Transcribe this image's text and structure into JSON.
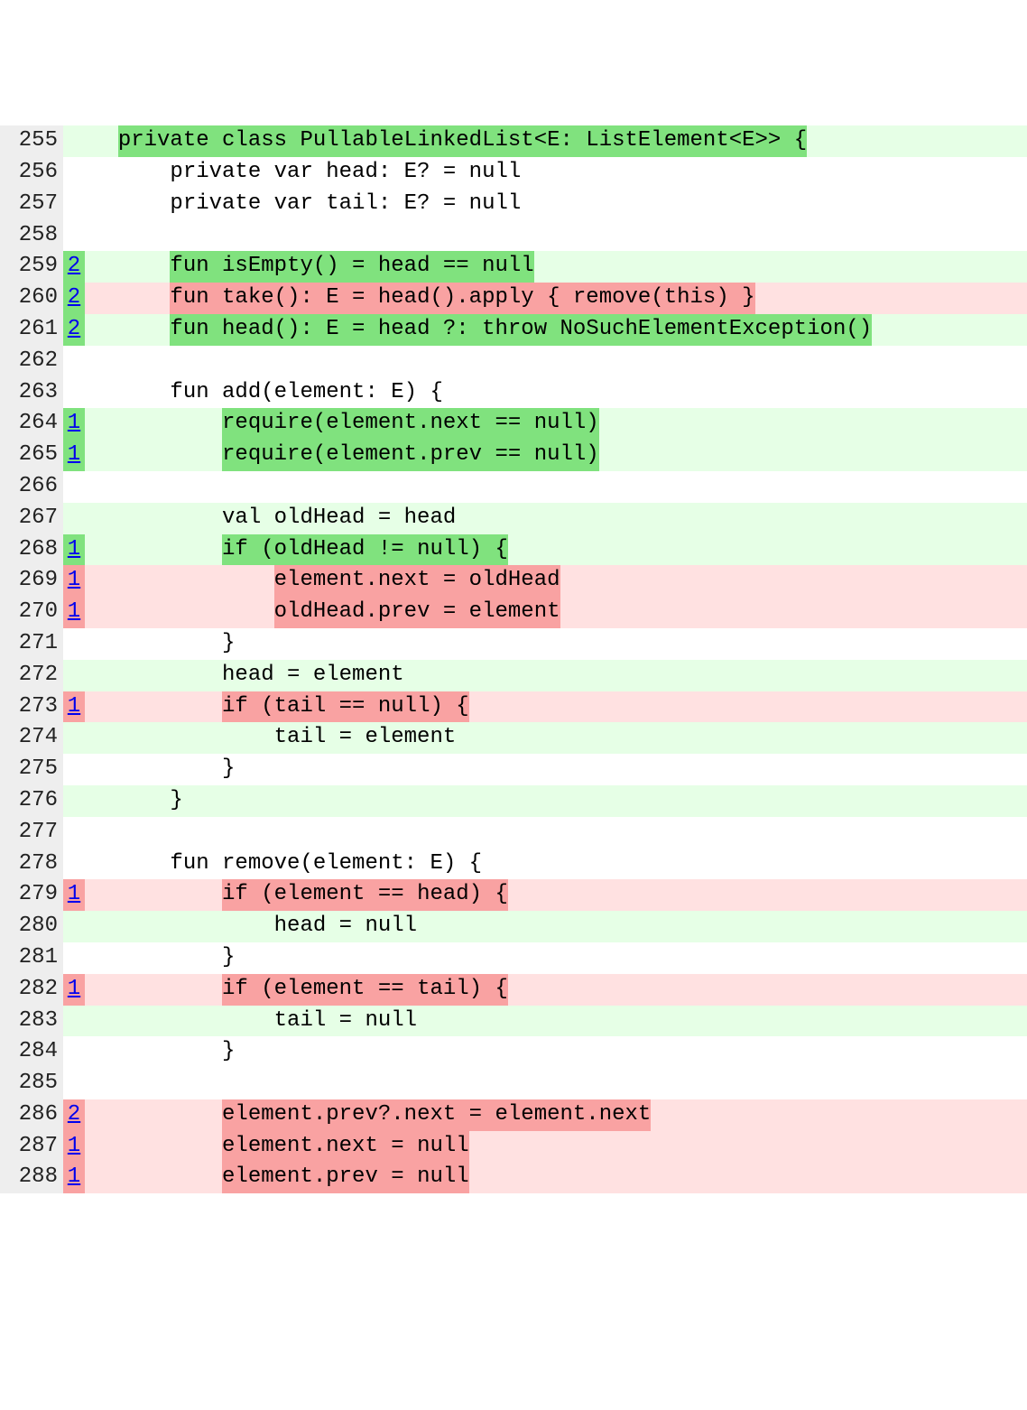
{
  "lines": [
    {
      "n": "255",
      "annot": "",
      "annotCls": "",
      "rowCls": "row-light-green",
      "segs": [
        {
          "t": "  ",
          "cls": ""
        },
        {
          "t": "private class PullableLinkedList<E: ListElement<E>> {",
          "cls": "hl-green"
        }
      ]
    },
    {
      "n": "256",
      "annot": "",
      "annotCls": "",
      "rowCls": "row-white",
      "segs": [
        {
          "t": "      private var head: E? = null",
          "cls": ""
        }
      ]
    },
    {
      "n": "257",
      "annot": "",
      "annotCls": "",
      "rowCls": "row-white",
      "segs": [
        {
          "t": "      private var tail: E? = null",
          "cls": ""
        }
      ]
    },
    {
      "n": "258",
      "annot": "",
      "annotCls": "",
      "rowCls": "row-white",
      "segs": [
        {
          "t": "",
          "cls": ""
        }
      ]
    },
    {
      "n": "259",
      "annot": "2",
      "annotCls": "annot-green",
      "rowCls": "row-light-green",
      "segs": [
        {
          "t": "      ",
          "cls": ""
        },
        {
          "t": "fun isEmpty() = head == null",
          "cls": "hl-green"
        }
      ]
    },
    {
      "n": "260",
      "annot": "2",
      "annotCls": "annot-green",
      "rowCls": "row-light-red",
      "segs": [
        {
          "t": "      ",
          "cls": ""
        },
        {
          "t": "fun take(): E = head().apply { remove(this) }",
          "cls": "hl-red"
        }
      ]
    },
    {
      "n": "261",
      "annot": "2",
      "annotCls": "annot-green",
      "rowCls": "row-light-green",
      "segs": [
        {
          "t": "      ",
          "cls": ""
        },
        {
          "t": "fun head(): E = head ?: throw NoSuchElementException()",
          "cls": "hl-green"
        }
      ]
    },
    {
      "n": "262",
      "annot": "",
      "annotCls": "",
      "rowCls": "row-white",
      "segs": [
        {
          "t": "",
          "cls": ""
        }
      ]
    },
    {
      "n": "263",
      "annot": "",
      "annotCls": "",
      "rowCls": "row-white",
      "segs": [
        {
          "t": "      fun add(element: E) {",
          "cls": ""
        }
      ]
    },
    {
      "n": "264",
      "annot": "1",
      "annotCls": "annot-green",
      "rowCls": "row-light-green",
      "segs": [
        {
          "t": "          ",
          "cls": ""
        },
        {
          "t": "require(element.next == null)",
          "cls": "hl-green"
        }
      ]
    },
    {
      "n": "265",
      "annot": "1",
      "annotCls": "annot-green",
      "rowCls": "row-light-green",
      "segs": [
        {
          "t": "          ",
          "cls": ""
        },
        {
          "t": "require(element.prev == null)",
          "cls": "hl-green"
        }
      ]
    },
    {
      "n": "266",
      "annot": "",
      "annotCls": "",
      "rowCls": "row-white",
      "segs": [
        {
          "t": "",
          "cls": ""
        }
      ]
    },
    {
      "n": "267",
      "annot": "",
      "annotCls": "",
      "rowCls": "row-light-green",
      "segs": [
        {
          "t": "          val oldHead = head",
          "cls": ""
        }
      ]
    },
    {
      "n": "268",
      "annot": "1",
      "annotCls": "annot-green",
      "rowCls": "row-light-green",
      "segs": [
        {
          "t": "          ",
          "cls": ""
        },
        {
          "t": "if (oldHead != null) {",
          "cls": "hl-green"
        }
      ]
    },
    {
      "n": "269",
      "annot": "1",
      "annotCls": "annot-red",
      "rowCls": "row-light-red",
      "segs": [
        {
          "t": "              ",
          "cls": ""
        },
        {
          "t": "element.next = oldHead",
          "cls": "hl-red"
        }
      ]
    },
    {
      "n": "270",
      "annot": "1",
      "annotCls": "annot-red",
      "rowCls": "row-light-red",
      "segs": [
        {
          "t": "              ",
          "cls": ""
        },
        {
          "t": "oldHead.prev = element",
          "cls": "hl-red"
        }
      ]
    },
    {
      "n": "271",
      "annot": "",
      "annotCls": "",
      "rowCls": "row-white",
      "segs": [
        {
          "t": "          }",
          "cls": ""
        }
      ]
    },
    {
      "n": "272",
      "annot": "",
      "annotCls": "",
      "rowCls": "row-light-green",
      "segs": [
        {
          "t": "          head = element",
          "cls": ""
        }
      ]
    },
    {
      "n": "273",
      "annot": "1",
      "annotCls": "annot-red",
      "rowCls": "row-light-red",
      "segs": [
        {
          "t": "          ",
          "cls": ""
        },
        {
          "t": "if (tail == null) {",
          "cls": "hl-red"
        }
      ]
    },
    {
      "n": "274",
      "annot": "",
      "annotCls": "",
      "rowCls": "row-light-green",
      "segs": [
        {
          "t": "              tail = element",
          "cls": ""
        }
      ]
    },
    {
      "n": "275",
      "annot": "",
      "annotCls": "",
      "rowCls": "row-white",
      "segs": [
        {
          "t": "          }",
          "cls": ""
        }
      ]
    },
    {
      "n": "276",
      "annot": "",
      "annotCls": "",
      "rowCls": "row-light-green",
      "segs": [
        {
          "t": "      }",
          "cls": ""
        }
      ]
    },
    {
      "n": "277",
      "annot": "",
      "annotCls": "",
      "rowCls": "row-white",
      "segs": [
        {
          "t": "",
          "cls": ""
        }
      ]
    },
    {
      "n": "278",
      "annot": "",
      "annotCls": "",
      "rowCls": "row-white",
      "segs": [
        {
          "t": "      fun remove(element: E) {",
          "cls": ""
        }
      ]
    },
    {
      "n": "279",
      "annot": "1",
      "annotCls": "annot-red",
      "rowCls": "row-light-red",
      "segs": [
        {
          "t": "          ",
          "cls": ""
        },
        {
          "t": "if (element == head) {",
          "cls": "hl-red"
        }
      ]
    },
    {
      "n": "280",
      "annot": "",
      "annotCls": "",
      "rowCls": "row-light-green",
      "segs": [
        {
          "t": "              head = null",
          "cls": ""
        }
      ]
    },
    {
      "n": "281",
      "annot": "",
      "annotCls": "",
      "rowCls": "row-white",
      "segs": [
        {
          "t": "          }",
          "cls": ""
        }
      ]
    },
    {
      "n": "282",
      "annot": "1",
      "annotCls": "annot-red",
      "rowCls": "row-light-red",
      "segs": [
        {
          "t": "          ",
          "cls": ""
        },
        {
          "t": "if (element == tail) {",
          "cls": "hl-red"
        }
      ]
    },
    {
      "n": "283",
      "annot": "",
      "annotCls": "",
      "rowCls": "row-light-green",
      "segs": [
        {
          "t": "              tail = null",
          "cls": ""
        }
      ]
    },
    {
      "n": "284",
      "annot": "",
      "annotCls": "",
      "rowCls": "row-white",
      "segs": [
        {
          "t": "          }",
          "cls": ""
        }
      ]
    },
    {
      "n": "285",
      "annot": "",
      "annotCls": "",
      "rowCls": "row-white",
      "segs": [
        {
          "t": "",
          "cls": ""
        }
      ]
    },
    {
      "n": "286",
      "annot": "2",
      "annotCls": "annot-red",
      "rowCls": "row-light-red",
      "segs": [
        {
          "t": "          ",
          "cls": ""
        },
        {
          "t": "element.prev?.next = element.next",
          "cls": "hl-red"
        }
      ]
    },
    {
      "n": "287",
      "annot": "1",
      "annotCls": "annot-red",
      "rowCls": "row-light-red",
      "segs": [
        {
          "t": "          ",
          "cls": ""
        },
        {
          "t": "element.next = null",
          "cls": "hl-red"
        }
      ]
    },
    {
      "n": "288",
      "annot": "1",
      "annotCls": "annot-red",
      "rowCls": "row-light-red",
      "segs": [
        {
          "t": "          ",
          "cls": ""
        },
        {
          "t": "element.prev = null",
          "cls": "hl-red"
        }
      ]
    }
  ]
}
